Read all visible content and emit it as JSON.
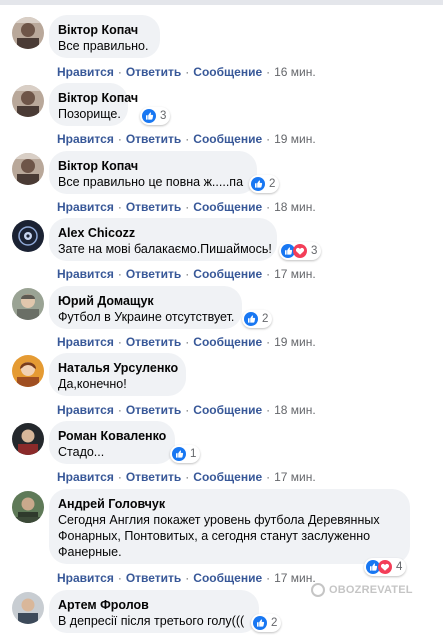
{
  "labels": {
    "like": "Нравится",
    "reply": "Ответить",
    "message": "Сообщение",
    "sep": "·"
  },
  "colors": {
    "action_link": "#385898",
    "bubble_bg": "#f0f2f5",
    "like_blue": "#1877f2",
    "love_red": "#f33e58",
    "muted": "#65676b"
  },
  "comments": [
    {
      "author": "Віктор Копач",
      "text": "Все правильно.",
      "reactions": null,
      "time": "16 мин."
    },
    {
      "author": "Віктор Копач",
      "text": "Позорище.",
      "reactions": {
        "types": [
          "like"
        ],
        "count": "3"
      },
      "time": "19 мин."
    },
    {
      "author": "Віктор Копач",
      "text": "Все правильно це повна ж.....па",
      "reactions": {
        "types": [
          "like"
        ],
        "count": "2"
      },
      "time": "18 мин."
    },
    {
      "author": "Alex Chicozz",
      "text": "Зате на мові балакаємо.Пишаймось!",
      "reactions": {
        "types": [
          "like",
          "love"
        ],
        "count": "3"
      },
      "time": "17 мин."
    },
    {
      "author": "Юрий Домащук",
      "text": "Футбол в Украине отсутствует.",
      "reactions": {
        "types": [
          "like"
        ],
        "count": "2"
      },
      "time": "19 мин."
    },
    {
      "author": "Наталья Урсуленко",
      "text": "Да,конечно!",
      "reactions": null,
      "time": "18 мин."
    },
    {
      "author": "Роман Коваленко",
      "text": "Стадо...",
      "reactions": {
        "types": [
          "like"
        ],
        "count": "1"
      },
      "time": "17 мин."
    },
    {
      "author": "Андрей Головчук",
      "text": "Сегодня Англия покажет уровень футбола Деревянных Фонарных, Понтовитых, а сегодня станут заслуженно Фанерные.",
      "reactions": {
        "types": [
          "like",
          "love"
        ],
        "count": "4"
      },
      "time": "17 мин."
    },
    {
      "author": "Артем Фролов",
      "text": "В депресії після третього голу(((",
      "reactions": {
        "types": [
          "like"
        ],
        "count": "2"
      },
      "time": null
    }
  ],
  "watermark": "OBOZREVATEL"
}
